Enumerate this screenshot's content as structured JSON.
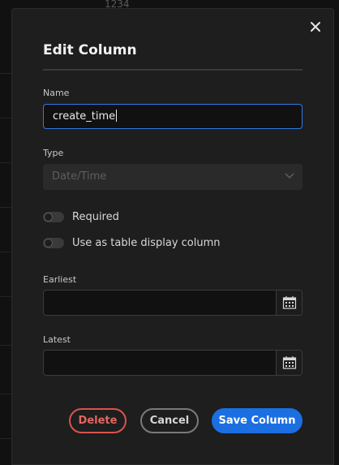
{
  "background": {
    "cell_text": "1234"
  },
  "dialog": {
    "title": "Edit Column",
    "close_icon": "close-icon",
    "name": {
      "label": "Name",
      "value": "create_time"
    },
    "type": {
      "label": "Type",
      "value": "Date/Time",
      "disabled": true
    },
    "required": {
      "label": "Required",
      "checked": false
    },
    "display_column": {
      "label": "Use as table display column",
      "checked": false
    },
    "earliest": {
      "label": "Earliest",
      "value": ""
    },
    "latest": {
      "label": "Latest",
      "value": ""
    },
    "buttons": {
      "delete": "Delete",
      "cancel": "Cancel",
      "save": "Save Column"
    }
  },
  "colors": {
    "accent": "#1b6fe0",
    "focus_border": "#2f7ce6",
    "danger": "#d9534f",
    "modal_bg": "#1e1e1e"
  }
}
